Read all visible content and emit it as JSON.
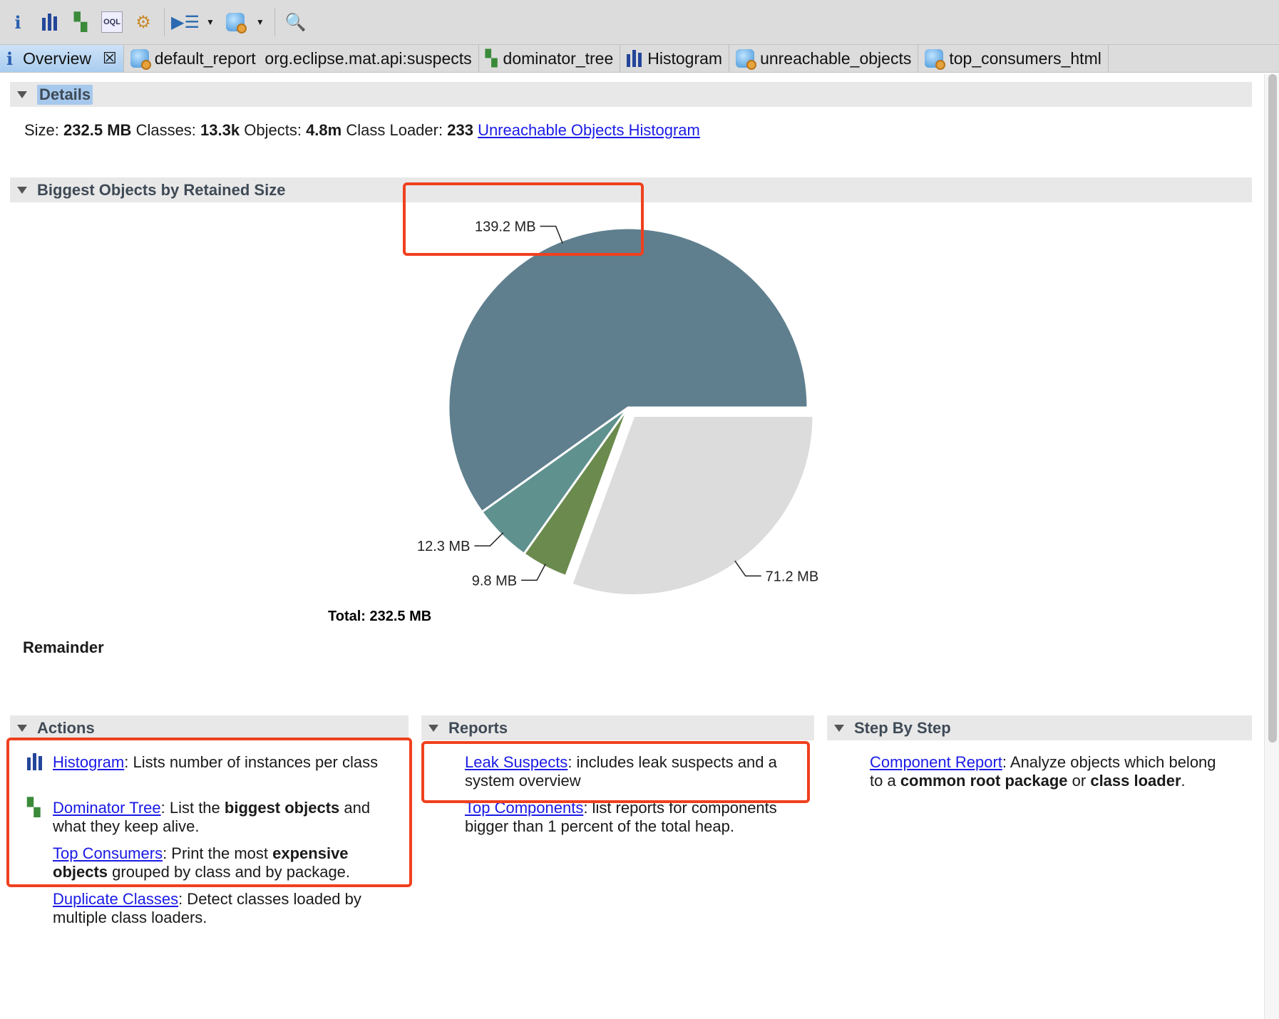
{
  "toolbar": {
    "icons": [
      "info-icon",
      "histogram-icon",
      "dominator-tree-icon",
      "oql-icon",
      "gear-icon",
      "query-browser-icon",
      "report-icon",
      "search-icon"
    ]
  },
  "tabs": [
    {
      "label": "Overview",
      "icon": "info-icon",
      "active": true,
      "closable": true
    },
    {
      "label": "default_report  org.eclipse.mat.api:suspects",
      "icon": "report-icon"
    },
    {
      "label": "dominator_tree",
      "icon": "dominator-tree-icon"
    },
    {
      "label": "Histogram",
      "icon": "histogram-icon"
    },
    {
      "label": "unreachable_objects",
      "icon": "report-icon"
    },
    {
      "label": "top_consumers_html",
      "icon": "report-icon"
    }
  ],
  "details": {
    "title": "Details",
    "size_label": "Size:",
    "size": "232.5 MB",
    "classes_label": "Classes:",
    "classes": "13.3k",
    "objects_label": "Objects:",
    "objects": "4.8m",
    "loader_label": "Class Loader:",
    "loader": "233",
    "link": "Unreachable Objects Histogram"
  },
  "biggest": {
    "title": "Biggest Objects by Retained Size",
    "remainder": "Remainder"
  },
  "chart_data": {
    "type": "pie",
    "values": [
      139.2,
      12.3,
      9.8,
      71.2
    ],
    "labels": [
      "139.2 MB",
      "12.3 MB",
      "9.8 MB",
      "71.2 MB"
    ],
    "colors": [
      "#5f7f8e",
      "#5f918f",
      "#6b8a4e",
      "#dcdcdc"
    ],
    "exploded": [
      false,
      false,
      false,
      true
    ],
    "total_label": "Total: 232.5 MB"
  },
  "actions": {
    "title": "Actions",
    "items": [
      {
        "link": "Histogram",
        "text": ": Lists number of instances per class",
        "icon": "histogram-icon"
      },
      {
        "link": "Dominator Tree",
        "pre": ": List the ",
        "bold": "biggest objects",
        "post": " and what they keep alive.",
        "icon": "dominator-tree-icon"
      },
      {
        "link": "Top Consumers",
        "pre": ": Print the most ",
        "bold": "expensive objects",
        "post": " grouped by class and by package."
      },
      {
        "link": "Duplicate Classes",
        "text": ": Detect classes loaded by multiple class loaders."
      }
    ]
  },
  "reports": {
    "title": "Reports",
    "items": [
      {
        "link": "Leak Suspects",
        "text": ": includes leak suspects and a system overview"
      },
      {
        "link": "Top Components",
        "text": ": list reports for components bigger than 1 percent of the total heap."
      }
    ]
  },
  "step": {
    "title": "Step By Step",
    "items": [
      {
        "link": "Component Report",
        "pre": ": Analyze objects which belong to a ",
        "bold": "common root package",
        "mid": " or ",
        "bold2": "class loader",
        "post": "."
      }
    ]
  }
}
